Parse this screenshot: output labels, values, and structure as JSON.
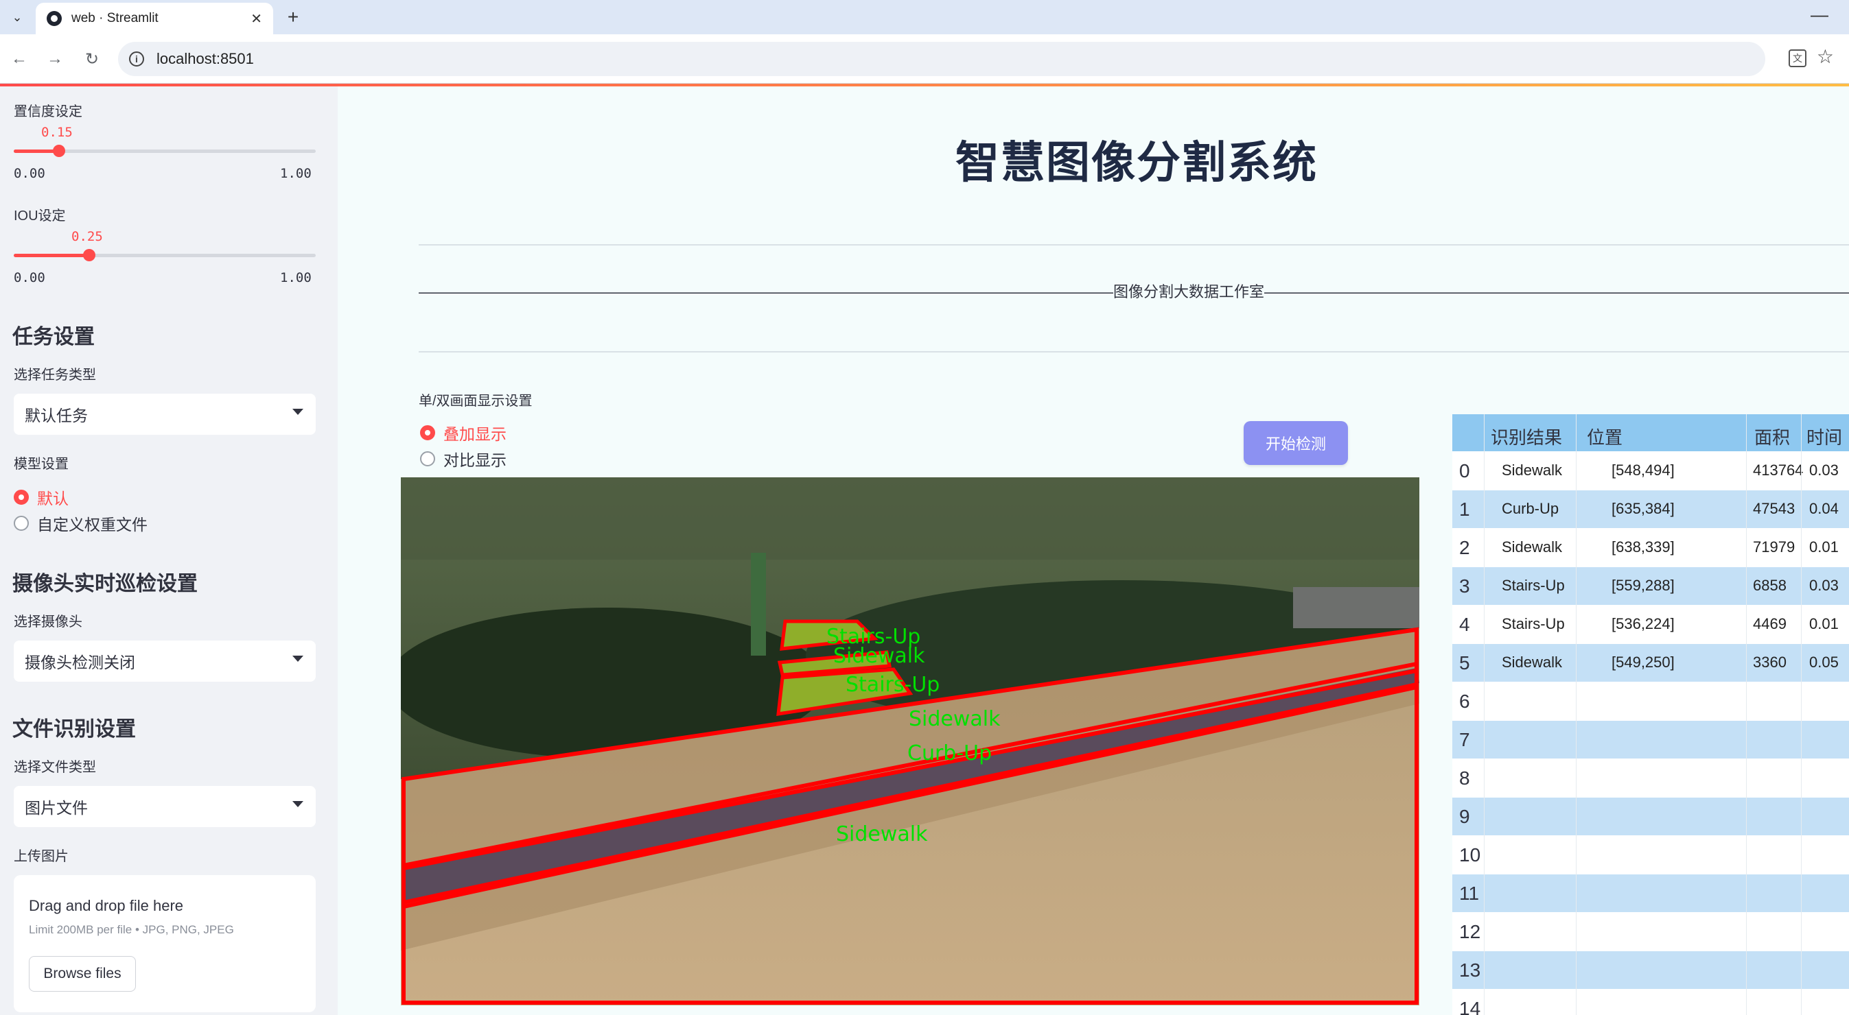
{
  "browser": {
    "tab_title": "web · Streamlit",
    "url": "localhost:8501"
  },
  "sidebar": {
    "confidence": {
      "label": "置信度设定",
      "value": "0.15",
      "value_num": 0.15,
      "min": "0.00",
      "max": "1.00"
    },
    "iou": {
      "label": "IOU设定",
      "value": "0.25",
      "value_num": 0.25,
      "min": "0.00",
      "max": "1.00"
    },
    "task_heading": "任务设置",
    "task_type_label": "选择任务类型",
    "task_type_value": "默认任务",
    "model_label": "模型设置",
    "model_options": [
      "默认",
      "自定义权重文件"
    ],
    "model_selected": 0,
    "camera_heading": "摄像头实时巡检设置",
    "camera_label": "选择摄像头",
    "camera_value": "摄像头检测关闭",
    "file_heading": "文件识别设置",
    "file_type_label": "选择文件类型",
    "file_type_value": "图片文件",
    "upload_label": "上传图片",
    "upload_title": "Drag and drop file here",
    "upload_limit": "Limit 200MB per file • JPG, PNG, JPEG",
    "upload_button": "Browse files"
  },
  "main": {
    "title": "智慧图像分割系统",
    "subtitle": "——————————————————————————————————————————————图像分割大数据工作室——————————————————————————————————————————————————",
    "display_mode_label": "单/双画面显示设置",
    "display_options": [
      "叠加显示",
      "对比显示"
    ],
    "display_selected": 0,
    "start_button": "开始检测"
  },
  "detections_overlay": {
    "labels": [
      "Stairs-Up",
      "Sidewalk",
      "Stairs-Up",
      "Sidewalk",
      "Curb-Up",
      "Sidewalk"
    ],
    "label_color": "#00e000",
    "outline_color": "#ff0000"
  },
  "table": {
    "columns": [
      "识别结果",
      "位置",
      "面积",
      "时间"
    ],
    "rows": [
      {
        "index": "0",
        "result": "Sidewalk",
        "position": "[548,494]",
        "area": "413764",
        "time": "0.03"
      },
      {
        "index": "1",
        "result": "Curb-Up",
        "position": "[635,384]",
        "area": "47543",
        "time": "0.04"
      },
      {
        "index": "2",
        "result": "Sidewalk",
        "position": "[638,339]",
        "area": "71979",
        "time": "0.01"
      },
      {
        "index": "3",
        "result": "Stairs-Up",
        "position": "[559,288]",
        "area": "6858",
        "time": "0.03"
      },
      {
        "index": "4",
        "result": "Stairs-Up",
        "position": "[536,224]",
        "area": "4469",
        "time": "0.01"
      },
      {
        "index": "5",
        "result": "Sidewalk",
        "position": "[549,250]",
        "area": "3360",
        "time": "0.05"
      },
      {
        "index": "6",
        "result": "",
        "position": "",
        "area": "",
        "time": ""
      },
      {
        "index": "7",
        "result": "",
        "position": "",
        "area": "",
        "time": ""
      },
      {
        "index": "8",
        "result": "",
        "position": "",
        "area": "",
        "time": ""
      },
      {
        "index": "9",
        "result": "",
        "position": "",
        "area": "",
        "time": ""
      },
      {
        "index": "10",
        "result": "",
        "position": "",
        "area": "",
        "time": ""
      },
      {
        "index": "11",
        "result": "",
        "position": "",
        "area": "",
        "time": ""
      },
      {
        "index": "12",
        "result": "",
        "position": "",
        "area": "",
        "time": ""
      },
      {
        "index": "13",
        "result": "",
        "position": "",
        "area": "",
        "time": ""
      },
      {
        "index": "14",
        "result": "",
        "position": "",
        "area": "",
        "time": ""
      }
    ]
  },
  "colors": {
    "accent": "#ff4b4b",
    "sidebar_bg": "#f0f2f6",
    "main_bg": "#f4fcfc",
    "button_bg": "#8c91f2",
    "table_header": "#8ec8f0",
    "table_band": "#c4e0f6"
  }
}
